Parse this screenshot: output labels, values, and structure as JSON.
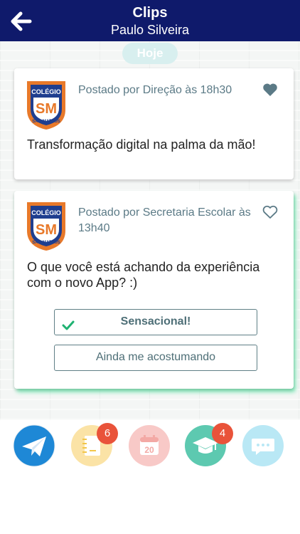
{
  "header": {
    "title": "Clips",
    "subtitle": "Paulo Silveira"
  },
  "feed": {
    "day_label": "Hoje",
    "posts": [
      {
        "author_line": "Postado por Direção às 18h30",
        "message": "Transformação digital na palma da mão!",
        "liked": true
      },
      {
        "author_line": "Postado por Secretaria Escolar às 13h40",
        "message": "O que você está achando da experiência com o novo App? :)",
        "liked": false,
        "options": [
          {
            "label": "Sensacional!",
            "selected": true
          },
          {
            "label": "Ainda me acostumando",
            "selected": false
          }
        ]
      }
    ]
  },
  "tabbar": {
    "tabs": [
      {
        "icon": "paper-plane-icon",
        "badge": ""
      },
      {
        "icon": "notebook-icon",
        "badge": "6"
      },
      {
        "icon": "calendar-icon",
        "badge": ""
      },
      {
        "icon": "graduation-cap-icon",
        "badge": "4"
      },
      {
        "icon": "chat-bubble-icon",
        "badge": ""
      }
    ]
  },
  "colors": {
    "header_bg": "#0f1a6b",
    "logo_orange": "#e8792a",
    "logo_blue": "#1f3e8f",
    "badge": "#e9533a",
    "check_green": "#1fb272",
    "highlight_glow": "#64e6aa"
  }
}
